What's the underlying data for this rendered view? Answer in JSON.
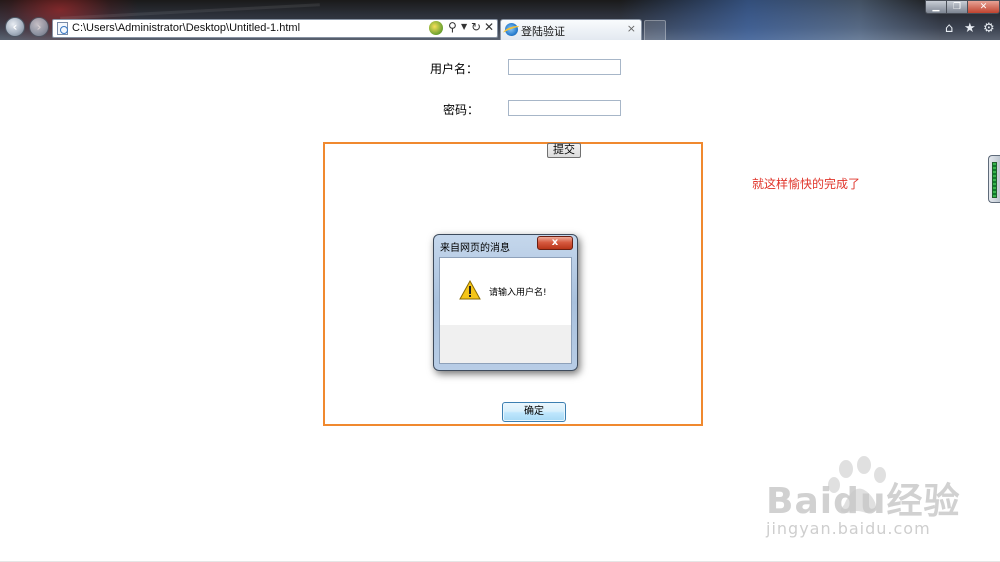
{
  "browser": {
    "address": "C:\\Users\\Administrator\\Desktop\\Untitled-1.html",
    "tab_title": "登陆验证",
    "tab_close": "×",
    "icons": {
      "back": "back-arrow-icon",
      "forward": "forward-arrow-icon",
      "page": "html-page-icon",
      "compat": "compatibility-view-icon",
      "search": "search-icon",
      "refresh": "refresh-icon",
      "stop": "stop-icon",
      "home": "home-icon",
      "favorites": "favorites-star-icon",
      "tools": "gear-icon"
    }
  },
  "form": {
    "username_label": "用户名：",
    "password_label": "密码：",
    "username_value": "",
    "password_value": "",
    "submit_label": "提交"
  },
  "annotation": {
    "text": "就这样愉快的完成了",
    "color": "#e0352b"
  },
  "highlight": {
    "color": "#f0892f"
  },
  "dialog": {
    "title": "来自网页的消息",
    "message": "请输入用户名!",
    "ok_label": "确定",
    "icon": "warning-icon"
  },
  "watermark": {
    "brand": "Baidu经验",
    "url": "jingyan.baidu.com"
  }
}
